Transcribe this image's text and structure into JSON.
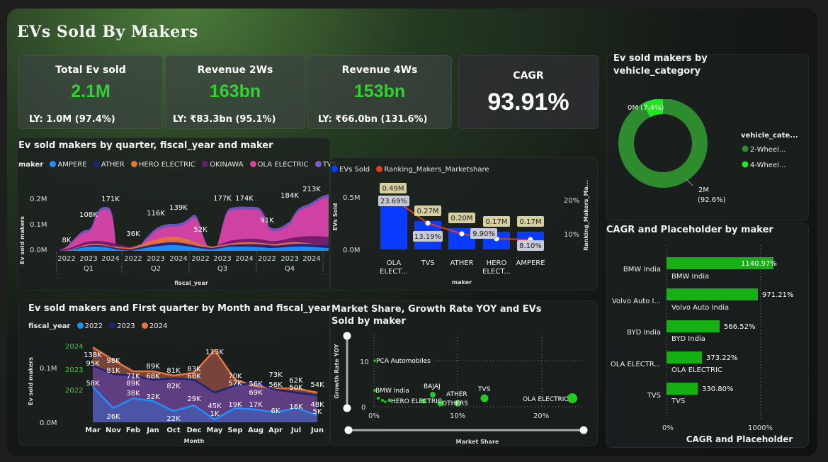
{
  "title": "EVs Sold By Makers",
  "kpis": [
    {
      "title": "Total Ev sold",
      "value": "2.1M",
      "ly": "LY: 1.0M (97.4%)"
    },
    {
      "title": "Revenue 2Ws",
      "value": "163bn",
      "ly": "LY: ₹83.3bn (95.1%)"
    },
    {
      "title": "Revenue 4Ws",
      "value": "153bn",
      "ly": "LY: ₹66.0bn (131.6%)"
    },
    {
      "title": "CAGR",
      "value": "93.91%"
    }
  ],
  "colors": {
    "accent_green": "#2fd42f",
    "bar_blue": "#0a3cff",
    "bar_green": "#14b014",
    "line_red": "#e0401c",
    "label_bg": "#d6cfa0"
  },
  "quarter_chart": {
    "title": "Ev sold makers by quarter, fiscal_year and maker",
    "legend_label": "maker",
    "legend": [
      {
        "name": "AMPERE",
        "color": "#1e90ff"
      },
      {
        "name": "ATHER",
        "color": "#1a237e"
      },
      {
        "name": "HERO ELECTRIC",
        "color": "#e8743b"
      },
      {
        "name": "OKINAWA",
        "color": "#6a1b6a"
      },
      {
        "name": "OLA ELECTRIC",
        "color": "#e040a0"
      },
      {
        "name": "TVS",
        "color": "#7b5cd6"
      }
    ],
    "ylabel": "Ev sold makers",
    "xlabel": "fiscal_year",
    "yticks": [
      "0.2M",
      "0.1M",
      "0.0M"
    ],
    "quarters": [
      "Q1",
      "Q2",
      "Q3",
      "Q4"
    ],
    "years": [
      "2022",
      "2023",
      "2024",
      "2022",
      "2023",
      "2024",
      "2022",
      "2023",
      "2024",
      "2022",
      "2023",
      "2024"
    ],
    "totals": [
      "8K",
      "108K",
      "171K",
      "36K",
      "116K",
      "139K",
      "52K",
      "177K",
      "174K",
      "91K",
      "184K",
      "213K"
    ]
  },
  "makers_chart": {
    "legend": [
      "EVs Sold",
      "Ranking_Makers_Marketshare"
    ],
    "ylabel": "EVs Sold",
    "y2label": "Ranking_Makers_Ma...",
    "xlabel": "maker",
    "yticks": [
      "0.5M",
      "0.0M"
    ],
    "y2ticks": [
      "20%",
      "10%"
    ],
    "categories": [
      "OLA\nELECT...",
      "TVS",
      "ATHER",
      "HERO\nELECT...",
      "AMPERE"
    ],
    "bar_labels": [
      "0.49M",
      "0.27M",
      "0.20M",
      "0.17M",
      "0.17M"
    ],
    "line_labels": [
      "23.69%",
      "13.19%",
      "9.90%",
      "",
      "8.10%"
    ]
  },
  "donut": {
    "title": "Ev sold makers by vehicle_category",
    "legend_title": "vehicle_cate...",
    "items": [
      {
        "name": "2-Wheel...",
        "color": "#2e8b2e"
      },
      {
        "name": "4-Wheel...",
        "color": "#22e622"
      }
    ],
    "label_small": "0M (7.4%)",
    "label_big_1": "2M",
    "label_big_2": "(92.6%)"
  },
  "month_chart": {
    "title": "Ev sold makers and First quarter by Month and fiscal_year",
    "legend_label": "fiscal_year",
    "legend": [
      {
        "name": "2022",
        "color": "#1e90ff"
      },
      {
        "name": "2023",
        "color": "#1a237e"
      },
      {
        "name": "2024",
        "color": "#e8743b"
      }
    ],
    "ylabel": "Ev sold makers",
    "xlabel": "Month",
    "yticks": [
      "0.1M",
      "0.0M"
    ],
    "year_marks": [
      "2024",
      "2023",
      "2022"
    ],
    "months": [
      "Mar",
      "Nov",
      "Feb",
      "Jan",
      "Oct",
      "Dec",
      "May",
      "Sep",
      "Aug",
      "Apr",
      "Jul",
      "Jun"
    ],
    "labels_2024": [
      "138K",
      "98K",
      "71K",
      "89K",
      "81K",
      "83K",
      "113K",
      "70K",
      "56K",
      "73K",
      "62K",
      "54K"
    ],
    "labels_2023": [
      "95K",
      "81K",
      "89K",
      "68K",
      "82K",
      "68K",
      "45K",
      "57K",
      "69K",
      "56K",
      "50K",
      "48K"
    ],
    "labels_2022": [
      "58K",
      "26K",
      "38K",
      "32K",
      "22K",
      "29K",
      "1K",
      "19K",
      "17K",
      "6K",
      "16K",
      "5K"
    ]
  },
  "scatter": {
    "title": "Market Share, Growth Rate YOY and EVs Sold by maker",
    "ylabel": "Growth Rate YOY",
    "xlabel": "Market Share",
    "yticks": [
      "10",
      "0"
    ],
    "xticks": [
      "0%",
      "10%",
      "20%"
    ],
    "points": [
      "PCA Automobiles",
      "BMW India",
      "HERO ELECTRIC",
      "BAJAJ",
      "ATHER",
      "OTHERS",
      "TVS",
      "OLA ELECTRIC"
    ]
  },
  "cagr_chart": {
    "title": "CAGR and Placeholder by maker",
    "xlabel": "CAGR and Placeholder",
    "xticks": [
      "0%",
      "1000%"
    ],
    "items": [
      {
        "name": "BMW India",
        "value": "1140.97%",
        "sub": "BMW India"
      },
      {
        "name": "Volvo Auto I...",
        "value": "971.21%",
        "sub": "Volvo Auto India"
      },
      {
        "name": "BYD India",
        "value": "566.52%",
        "sub": "BYD India"
      },
      {
        "name": "OLA ELECTR...",
        "value": "373.22%",
        "sub": "OLA ELECTRIC"
      },
      {
        "name": "TVS",
        "value": "330.80%",
        "sub": "TVS"
      }
    ]
  }
}
